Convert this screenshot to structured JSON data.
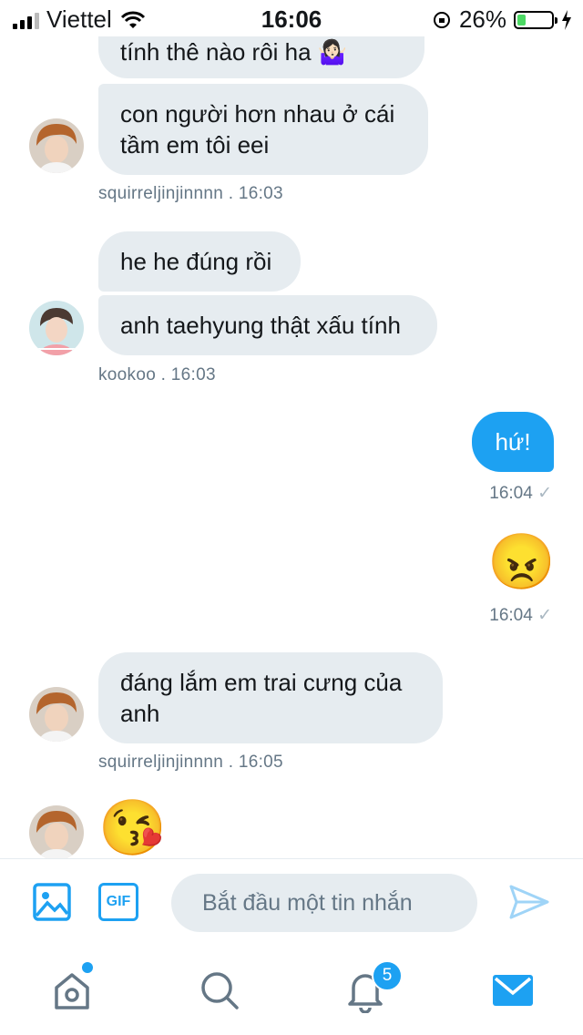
{
  "status_bar": {
    "carrier": "Viettel",
    "time": "16:06",
    "battery": "26%",
    "battery_level": 0.26
  },
  "messages": [
    {
      "id": "m1",
      "text": "tính thê nào rôi ha 🤷🏻‍♀️"
    },
    {
      "id": "m2",
      "text": "con người hơn nhau ở cái tầm em tôi eei"
    },
    {
      "id": "meta1",
      "text": "squirreljinjinnnn  . 16:03"
    },
    {
      "id": "m3",
      "text": "he he đúng rồi"
    },
    {
      "id": "m4",
      "text": "anh taehyung thật xấu tính"
    },
    {
      "id": "meta2",
      "text": "kookoo  . 16:03"
    },
    {
      "id": "m5",
      "text": "hứ!"
    },
    {
      "id": "meta3",
      "text": "16:04"
    },
    {
      "id": "m6",
      "text": "😠"
    },
    {
      "id": "meta4",
      "text": "16:04"
    },
    {
      "id": "m7",
      "text": "đáng lắm em trai cưng của anh"
    },
    {
      "id": "meta5",
      "text": "squirreljinjinnnn  . 16:05"
    },
    {
      "id": "m8",
      "text": "😘"
    }
  ],
  "read_mark": "✓",
  "compose": {
    "placeholder": "Bắt đầu một tin nhắn",
    "gif_label": "GIF"
  },
  "tabbar": {
    "notifications_count": "5"
  },
  "colors": {
    "accent": "#1da1f2",
    "bubble_in": "#e6ecf0",
    "meta": "#657786"
  }
}
